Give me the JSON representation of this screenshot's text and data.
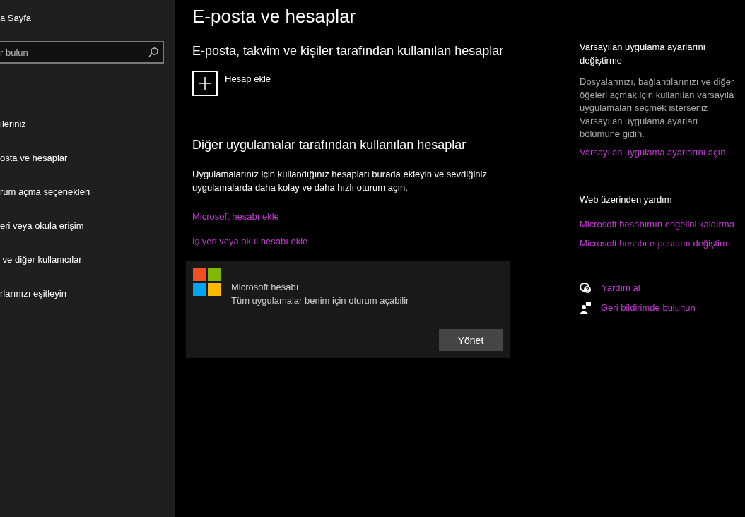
{
  "sidebar": {
    "home": "a Sayfa",
    "search": {
      "placeholder": "r bulun"
    },
    "items": [
      {
        "label": "ileriniz"
      },
      {
        "label": "osta ve hesaplar"
      },
      {
        "label": "rum açma seçenekleri"
      },
      {
        "label": "eri veya okula erişim"
      },
      {
        "label": " ve diğer kullanıcılar"
      },
      {
        "label": "rlarınızı eşitleyin"
      }
    ]
  },
  "main": {
    "title": "E-posta ve hesaplar",
    "section1": {
      "heading": "E-posta, takvim ve kişiler tarafından kullanılan hesaplar",
      "add": "Hesap ekle"
    },
    "section2": {
      "heading": "Diğer uygulamalar tarafından kullanılan hesaplar",
      "description": "Uygulamalarınız için kullandığınız hesapları burada ekleyin ve sevdiğiniz uygulamalarda daha kolay ve daha hızlı oturum açın.",
      "links": [
        "Microsoft hesabı ekle",
        "İş yeri veya okul hesabı ekle"
      ],
      "account": {
        "name": "Microsoft hesabı",
        "detail": "Tüm uygulamalar benim için oturum açabilir",
        "button": "Yönet"
      }
    }
  },
  "aside": {
    "default_apps": {
      "heading": "Varsayılan uygulama ayarlarını değiştirme",
      "lines": [
        "Dosyalarınızı, bağlantılarınızı ve diğer",
        "öğeleri açmak için kullanılan varsayıla",
        "uygulamaları seçmek isterseniz",
        "Varsayılan uygulama ayarları",
        "bölümüne gidin."
      ],
      "link": "Varsayılan uygulama ayarlarını açın"
    },
    "web_help": {
      "heading": "Web üzerinden yardım",
      "links": [
        "Microsoft hesabımın engelini kaldırma",
        "Microsoft hesabı e-postamı değiştirm"
      ]
    },
    "actions": [
      {
        "kind": "help",
        "label": "Yardım al"
      },
      {
        "kind": "feedback",
        "label": "Geri bildirimde bulunun"
      }
    ]
  }
}
